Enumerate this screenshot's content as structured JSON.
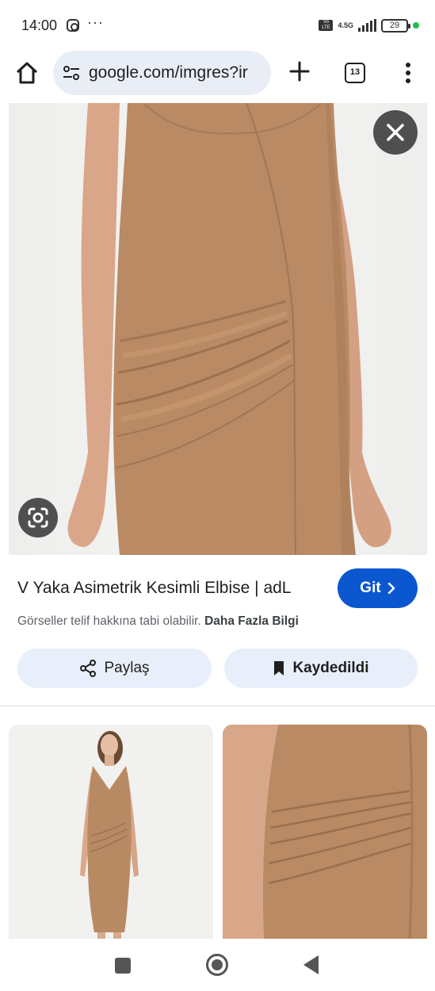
{
  "status_bar": {
    "time": "14:00",
    "notification_icons": [
      "instagram-icon",
      "more-dots-icon"
    ],
    "more_dots": "···",
    "volte_label": "Vo LTE",
    "network_label": "4.5G",
    "battery_level": "29",
    "colors": {
      "charging_dot": "#1fbf4a"
    }
  },
  "browser": {
    "url": "google.com/imgres?ir",
    "tab_count": "13",
    "icons": [
      "home-icon",
      "tune-icon",
      "plus-icon",
      "tabs-icon",
      "menu-dots-icon"
    ]
  },
  "viewer": {
    "image_subject": "Camel sleeveless asymmetric ruched dress",
    "close_icon": "close-icon",
    "lens_icon": "google-lens-icon",
    "title": "V Yaka Asimetrik Kesimli Elbise | adL",
    "visit_button": "Git",
    "visit_icon": "chevron-right-icon",
    "copyright_text": "Görseller telif hakkına tabi olabilir.",
    "learn_more": "Daha Fazla Bilgi",
    "share_button": "Paylaş",
    "share_icon": "share-icon",
    "saved_button": "Kaydedildi",
    "saved_icon": "bookmark-icon",
    "colors": {
      "accent": "#0b57d0",
      "pill_bg": "#e8effb",
      "dress": "#b98a64"
    }
  },
  "related_images": [
    {
      "subject": "Model wearing camel V-neck dress"
    },
    {
      "subject": "Close-up of ruched dress side"
    }
  ],
  "nav_bar": {
    "icons": [
      "recents-square-icon",
      "home-circle-icon",
      "back-triangle-icon"
    ]
  }
}
